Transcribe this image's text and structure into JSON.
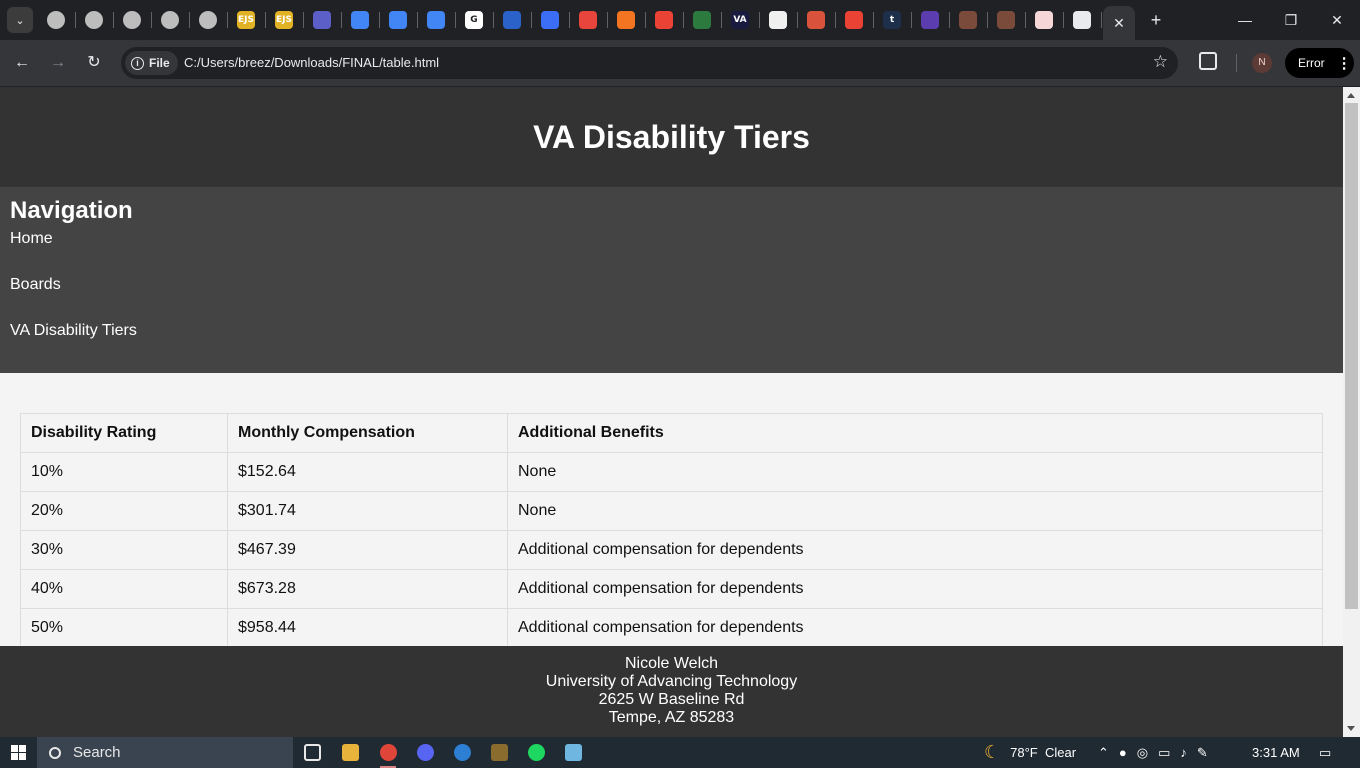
{
  "browser": {
    "address": {
      "chip_label": "File",
      "url": "C:/Users/breez/Downloads/FINAL/table.html"
    },
    "tab_icons": [
      {
        "name": "page-icon"
      },
      {
        "name": "page-icon"
      },
      {
        "name": "page-icon"
      },
      {
        "name": "page-icon"
      },
      {
        "name": "page-icon"
      },
      {
        "name": "ejs-icon",
        "text": "EJS"
      },
      {
        "name": "ejs-icon",
        "text": "EJS"
      },
      {
        "name": "teams-icon"
      },
      {
        "name": "docs-icon"
      },
      {
        "name": "docs-icon"
      },
      {
        "name": "docs-icon"
      },
      {
        "name": "google-icon",
        "text": "G"
      },
      {
        "name": "app-icon"
      },
      {
        "name": "play-icon"
      },
      {
        "name": "hubspot-icon"
      },
      {
        "name": "crunchyroll-icon"
      },
      {
        "name": "gmail-icon"
      },
      {
        "name": "app-icon"
      },
      {
        "name": "va-icon",
        "text": "VA"
      },
      {
        "name": "app-icon"
      },
      {
        "name": "app-icon"
      },
      {
        "name": "gmail-icon"
      },
      {
        "name": "tumblr-icon",
        "text": "t"
      },
      {
        "name": "code-icon"
      },
      {
        "name": "avatar-icon"
      },
      {
        "name": "avatar-icon"
      },
      {
        "name": "app-icon"
      },
      {
        "name": "github-icon"
      }
    ],
    "error_label": "Error",
    "profile_initial": "N"
  },
  "page": {
    "title": "VA Disability Tiers",
    "nav": {
      "heading": "Navigation",
      "links": [
        "Home",
        "Boards",
        "VA Disability Tiers"
      ]
    },
    "table": {
      "headers": [
        "Disability Rating",
        "Monthly Compensation",
        "Additional Benefits"
      ],
      "rows": [
        [
          "10%",
          "$152.64",
          "None"
        ],
        [
          "20%",
          "$301.74",
          "None"
        ],
        [
          "30%",
          "$467.39",
          "Additional compensation for dependents"
        ],
        [
          "40%",
          "$673.28",
          "Additional compensation for dependents"
        ],
        [
          "50%",
          "$958.44",
          "Additional compensation for dependents"
        ]
      ]
    },
    "footer": {
      "name": "Nicole Welch",
      "school": "University of Advancing Technology",
      "street": "2625 W Baseline Rd",
      "city": "Tempe, AZ 85283"
    }
  },
  "taskbar": {
    "search_label": "Search",
    "weather": "78°F  Clear",
    "time": "3:31 AM"
  }
}
